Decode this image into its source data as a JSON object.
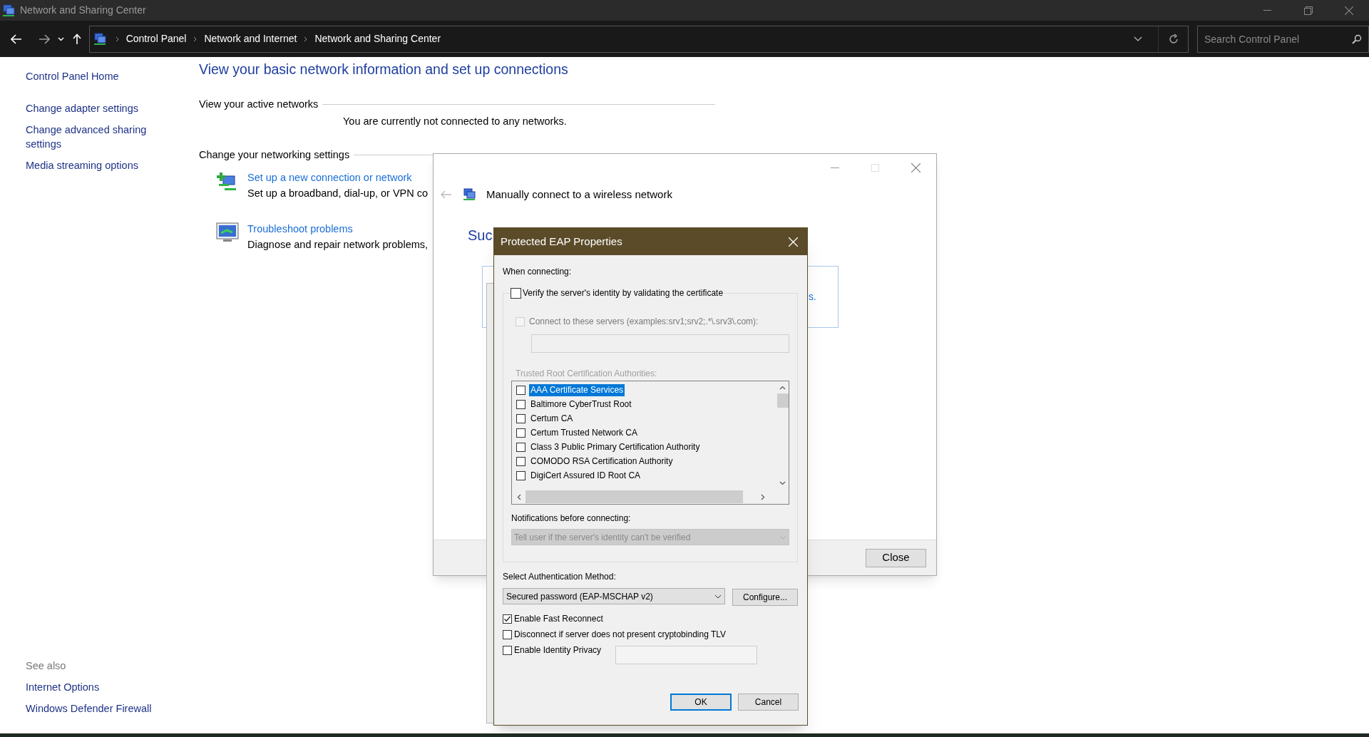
{
  "window": {
    "title": "Network and Sharing Center"
  },
  "address_bar": {
    "breadcrumbs": [
      "Control Panel",
      "Network and Internet",
      "Network and Sharing Center"
    ]
  },
  "search": {
    "placeholder": "Search Control Panel"
  },
  "sidebar": {
    "items": [
      "Control Panel Home",
      "Change adapter settings",
      "Change advanced sharing settings",
      "Media streaming options"
    ],
    "see_also_title": "See also",
    "see_also": [
      "Internet Options",
      "Windows Defender Firewall"
    ]
  },
  "main": {
    "heading": "View your basic network information and set up connections",
    "active_networks_title": "View your active networks",
    "active_networks_message": "You are currently not connected to any networks.",
    "settings_title": "Change your networking settings",
    "tasks": [
      {
        "kind": "setup",
        "link": "Set up a new connection or network",
        "description": "Set up a broadband, dial-up, or VPN co"
      },
      {
        "kind": "troubleshoot",
        "link": "Troubleshoot problems",
        "description": "Diagnose and repair network problems,"
      }
    ]
  },
  "wizard": {
    "title": "Manually connect to a wireless network",
    "heading": "Suc",
    "partial_link": "s.",
    "close_button": "Close"
  },
  "eap_dialog": {
    "title": "Protected EAP Properties",
    "when_connecting": "When connecting:",
    "verify": {
      "label": "Verify the server's identity by validating the certificate",
      "checked": false
    },
    "connect_servers": {
      "label": "Connect to these servers (examples:srv1;srv2;.*\\.srv3\\.com):",
      "checked": false,
      "disabled": true
    },
    "trusted_title": "Trusted Root Certification Authorities:",
    "authorities": [
      {
        "name": "AAA Certificate Services",
        "checked": false,
        "selected": true
      },
      {
        "name": "Baltimore CyberTrust Root",
        "checked": false,
        "selected": false
      },
      {
        "name": "Certum CA",
        "checked": false,
        "selected": false
      },
      {
        "name": "Certum Trusted Network CA",
        "checked": false,
        "selected": false
      },
      {
        "name": "Class 3 Public Primary Certification Authority",
        "checked": false,
        "selected": false
      },
      {
        "name": "COMODO RSA Certification Authority",
        "checked": false,
        "selected": false
      },
      {
        "name": "DigiCert Assured ID Root CA",
        "checked": false,
        "selected": false
      }
    ],
    "notifications_title": "Notifications before connecting:",
    "notifications_value": "Tell user if the server's identity can't be verified",
    "auth_title": "Select Authentication Method:",
    "auth_value": "Secured password (EAP-MSCHAP v2)",
    "configure_button": "Configure...",
    "options": [
      {
        "label": "Enable Fast Reconnect",
        "checked": true
      },
      {
        "label": "Disconnect if server does not present cryptobinding TLV",
        "checked": false
      },
      {
        "label": "Enable Identity Privacy",
        "checked": false
      }
    ],
    "ok_button": "OK",
    "cancel_button": "Cancel"
  }
}
